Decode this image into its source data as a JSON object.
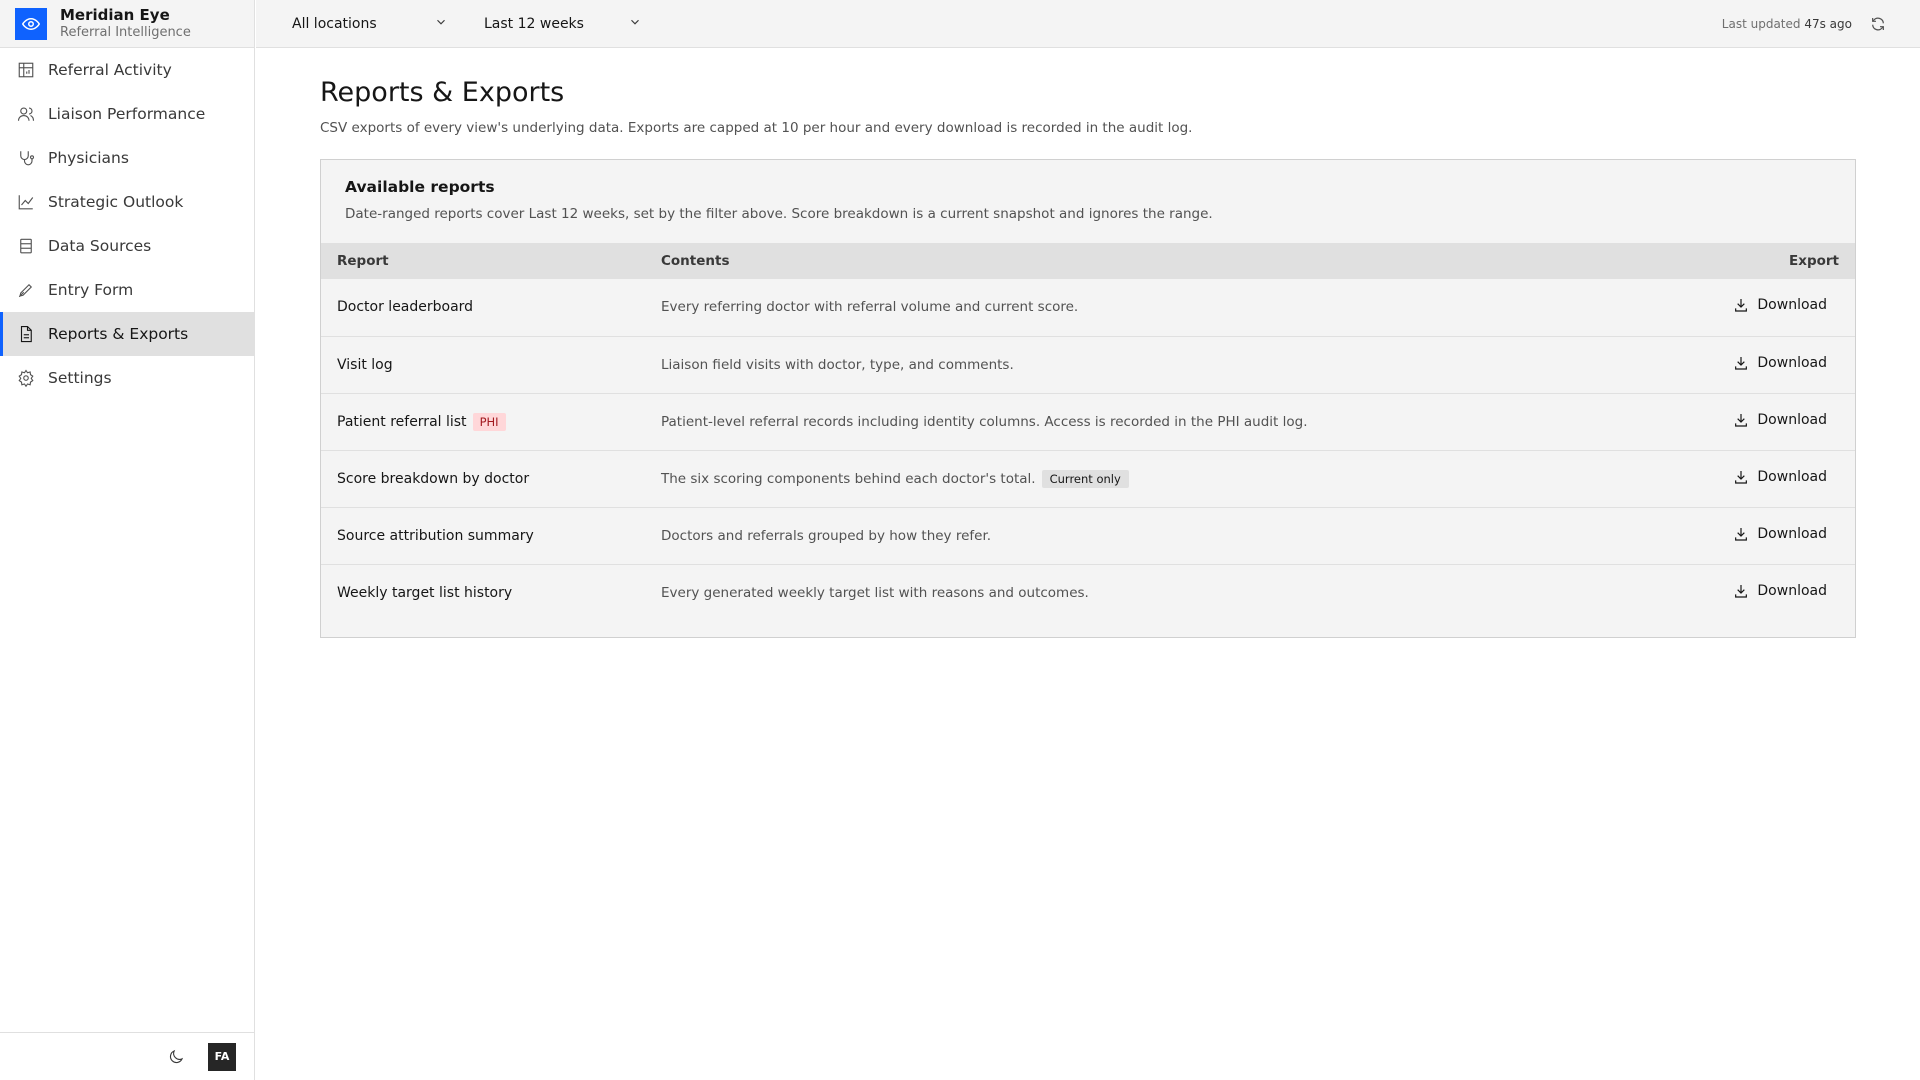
{
  "brand": {
    "name": "Meridian Eye",
    "subtitle": "Referral Intelligence",
    "icon": "eye-icon",
    "accent": "#0f62fe"
  },
  "sidebar": {
    "items": [
      {
        "label": "Referral Activity",
        "icon": "calendar-chart-icon",
        "active": false
      },
      {
        "label": "Liaison Performance",
        "icon": "users-icon",
        "active": false
      },
      {
        "label": "Physicians",
        "icon": "stethoscope-icon",
        "active": false
      },
      {
        "label": "Strategic Outlook",
        "icon": "line-chart-icon",
        "active": false
      },
      {
        "label": "Data Sources",
        "icon": "database-icon",
        "active": false
      },
      {
        "label": "Entry Form",
        "icon": "pen-icon",
        "active": false
      },
      {
        "label": "Reports & Exports",
        "icon": "document-icon",
        "active": true
      },
      {
        "label": "Settings",
        "icon": "gear-icon",
        "active": false
      }
    ],
    "footer": {
      "theme_icon": "moon-icon",
      "avatar_initials": "FA"
    }
  },
  "topbar": {
    "location_filter": "All locations",
    "range_filter": "Last 12 weeks",
    "last_updated_label": "Last updated",
    "last_updated_value": "47s ago",
    "refresh_icon": "refresh-icon"
  },
  "page": {
    "title": "Reports & Exports",
    "description": "CSV exports of every view's underlying data. Exports are capped at 10 per hour and every download is recorded in the audit log."
  },
  "reports_card": {
    "title": "Available reports",
    "description": "Date-ranged reports cover Last 12 weeks, set by the filter above. Score breakdown is a current snapshot and ignores the range.",
    "columns": {
      "report": "Report",
      "contents": "Contents",
      "export": "Export"
    },
    "rows": [
      {
        "report": "Doctor leaderboard",
        "badge": "",
        "contents": "Every referring doctor with referral volume and current score.",
        "contents_badge": "",
        "action": "Download"
      },
      {
        "report": "Visit log",
        "badge": "",
        "contents": "Liaison field visits with doctor, type, and comments.",
        "contents_badge": "",
        "action": "Download"
      },
      {
        "report": "Patient referral list",
        "badge": "PHI",
        "contents": "Patient-level referral records including identity columns. Access is recorded in the PHI audit log.",
        "contents_badge": "",
        "action": "Download"
      },
      {
        "report": "Score breakdown by doctor",
        "badge": "",
        "contents": "The six scoring components behind each doctor's total.",
        "contents_badge": "Current only",
        "action": "Download"
      },
      {
        "report": "Source attribution summary",
        "badge": "",
        "contents": "Doctors and referrals grouped by how they refer.",
        "contents_badge": "",
        "action": "Download"
      },
      {
        "report": "Weekly target list history",
        "badge": "",
        "contents": "Every generated weekly target list with reasons and outcomes.",
        "contents_badge": "",
        "action": "Download"
      }
    ]
  }
}
